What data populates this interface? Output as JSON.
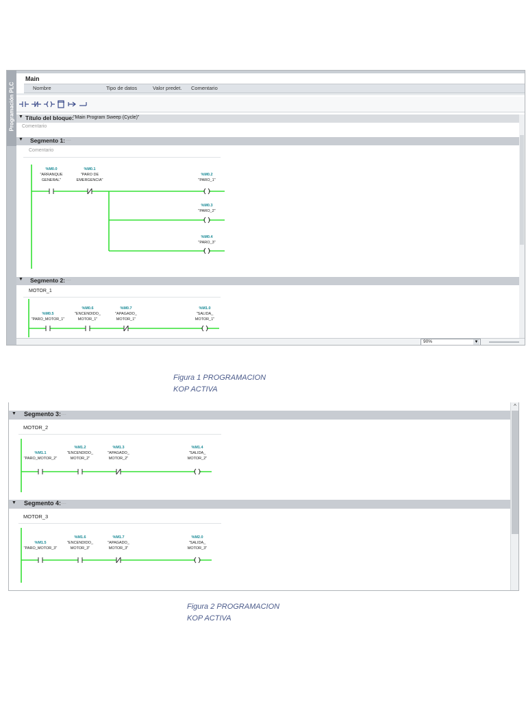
{
  "figure1": {
    "sidebar_label": "Programación PLC",
    "block_name": "Main",
    "columns": [
      "Nombre",
      "Tipo de datos",
      "Valor predet.",
      "Comentario"
    ],
    "block_title_label": "Título del bloque:",
    "block_title_value": "\"Main Program Sweep (Cycle)\"",
    "block_comment": "Comentario",
    "zoom": "90%",
    "segments": [
      {
        "label": "Segmento 1:",
        "ellipsis": "....",
        "comment": "Comentario",
        "contacts": [
          {
            "addr": "%M0.0",
            "line1": "\"ARRANQUE",
            "line2": "GENERAL\"",
            "type": "NO"
          },
          {
            "addr": "%M0.1",
            "line1": "\"PARO DE",
            "line2": "EMERGENCIA\"",
            "type": "NC"
          }
        ],
        "coils": [
          {
            "addr": "%M0.2",
            "name": "\"PARO_1\""
          },
          {
            "addr": "%M0.3",
            "name": "\"PARO_2\""
          },
          {
            "addr": "%M0.4",
            "name": "\"PARO_3\""
          }
        ]
      },
      {
        "label": "Segmento 2:",
        "ellipsis": "....",
        "comment": "MOTOR_1",
        "contacts": [
          {
            "addr": "%M0.5",
            "line1": "\"PARO_MOTOR_1\"",
            "line2": "",
            "type": "NO"
          },
          {
            "addr": "%M0.6",
            "line1": "\"ENCENDIDO_",
            "line2": "MOTOR_1\"",
            "type": "NO"
          },
          {
            "addr": "%M0.7",
            "line1": "\"APAGADO_",
            "line2": "MOTOR_1\"",
            "type": "NC"
          }
        ],
        "coils": [
          {
            "addr": "%M1.0",
            "line1": "\"SALIDA_",
            "line2": "MOTOR_1\""
          }
        ]
      }
    ]
  },
  "caption1": {
    "line1": "Figura 1 PROGRAMACION",
    "line2": "KOP ACTIVA"
  },
  "figure2": {
    "segments": [
      {
        "label": "Segmento 3:",
        "ellipsis": "....",
        "comment": "MOTOR_2",
        "contacts": [
          {
            "addr": "%M1.1",
            "line1": "\"PARO_MOTOR_2\"",
            "line2": "",
            "type": "NO"
          },
          {
            "addr": "%M1.2",
            "line1": "\"ENCENDIDO_",
            "line2": "MOTOR_2\"",
            "type": "NO"
          },
          {
            "addr": "%M1.3",
            "line1": "\"APAGADO_",
            "line2": "MOTOR_2\"",
            "type": "NC"
          }
        ],
        "coils": [
          {
            "addr": "%M1.4",
            "line1": "\"SALIDA_",
            "line2": "MOTOR_2\""
          }
        ]
      },
      {
        "label": "Segmento 4:",
        "ellipsis": "....",
        "comment": "MOTOR_3",
        "contacts": [
          {
            "addr": "%M1.5",
            "line1": "\"PARO_MOTOR_3\"",
            "line2": "",
            "type": "NO"
          },
          {
            "addr": "%M1.6",
            "line1": "\"ENCENDIDO_",
            "line2": "MOTOR_3\"",
            "type": "NO"
          },
          {
            "addr": "%M1.7",
            "line1": "\"APAGADO_",
            "line2": "MOTOR_3\"",
            "type": "NC"
          }
        ],
        "coils": [
          {
            "addr": "%M2.0",
            "line1": "\"SALIDA_",
            "line2": "MOTOR_3\""
          }
        ]
      }
    ]
  },
  "caption2": {
    "line1": "Figura 2 PROGRAMACION",
    "line2": "KOP ACTIVA"
  },
  "colors": {
    "rung": "#33e033",
    "addr": "#1a8a96",
    "segment_bar": "#c8ccd2"
  }
}
